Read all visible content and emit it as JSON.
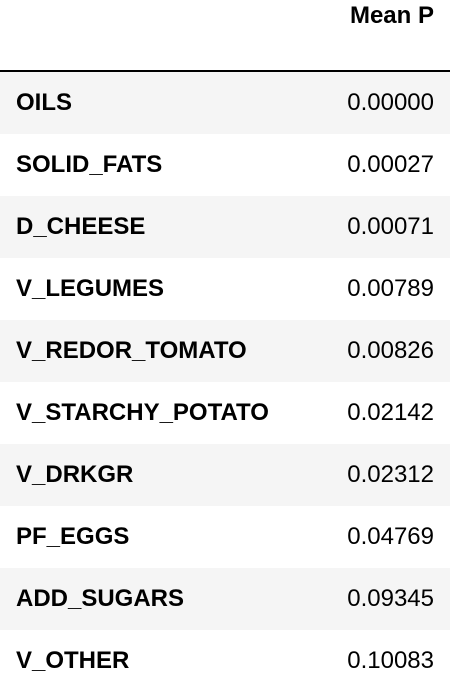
{
  "table": {
    "column_header": "Mean P",
    "rows": [
      {
        "label": "OILS",
        "value": "0.00000"
      },
      {
        "label": "SOLID_FATS",
        "value": "0.00027"
      },
      {
        "label": "D_CHEESE",
        "value": "0.00071"
      },
      {
        "label": "V_LEGUMES",
        "value": "0.00789"
      },
      {
        "label": "V_REDOR_TOMATO",
        "value": "0.00826"
      },
      {
        "label": "V_STARCHY_POTATO",
        "value": "0.02142"
      },
      {
        "label": "V_DRKGR",
        "value": "0.02312"
      },
      {
        "label": "PF_EGGS",
        "value": "0.04769"
      },
      {
        "label": "ADD_SUGARS",
        "value": "0.09345"
      },
      {
        "label": "V_OTHER",
        "value": "0.10083"
      }
    ]
  },
  "colors": {
    "stripe": "#f5f5f5",
    "background": "#ffffff",
    "text": "#000000",
    "rule": "#000000"
  }
}
